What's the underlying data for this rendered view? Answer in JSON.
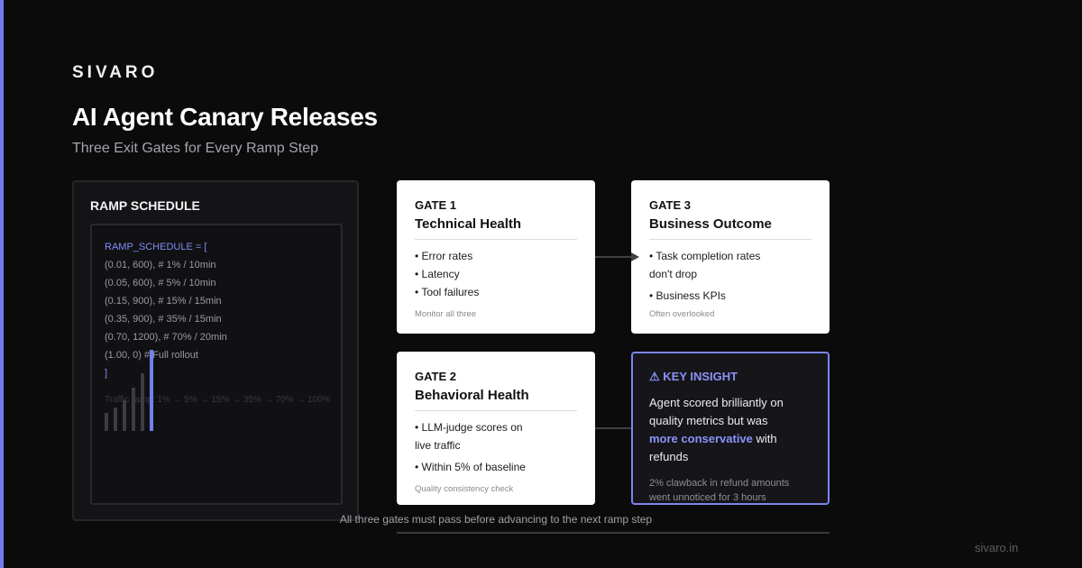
{
  "brand": "SIVARO",
  "title": "AI Agent Canary Releases",
  "subtitle": "Three Exit Gates for Every Ramp Step",
  "ramp": {
    "title": "RAMP SCHEDULE",
    "code": [
      "RAMP_SCHEDULE = [",
      "(0.01, 600), # 1% / 10min",
      "(0.05, 600), # 5% / 10min",
      "(0.15, 900), # 15% / 15min",
      "(0.35, 900), # 35% / 15min",
      "(0.70, 1200), # 70% / 20min",
      "(1.00, 0) # Full rollout",
      "]"
    ],
    "traffic_label": "Traffic ramp: 1% → 5% → 15% → 35% → 70% → 100%",
    "traffic_steps_percent": [
      1,
      5,
      15,
      35,
      70,
      100
    ]
  },
  "gates": {
    "gate1": {
      "label": "GATE 1",
      "name": "Technical Health",
      "items": [
        "• Error rates",
        "• Latency",
        "• Tool failures"
      ],
      "note": "Monitor all three"
    },
    "gate2": {
      "label": "GATE 2",
      "name": "Behavioral Health",
      "items": [
        "• LLM-judge scores on",
        "live traffic",
        "• Within 5% of baseline"
      ],
      "note": "Quality consistency check"
    },
    "gate3": {
      "label": "GATE 3",
      "name": "Business Outcome",
      "items": [
        "• Task completion rates",
        "don't drop",
        "• Business KPIs"
      ],
      "note": "Often overlooked"
    }
  },
  "insight": {
    "heading": "⚠ KEY INSIGHT",
    "line1": "Agent scored brilliantly on",
    "line2": "quality metrics but was",
    "highlight": "more conservative",
    "line3_rest": " with",
    "line4": "refunds",
    "foot1": "2% clawback in refund amounts",
    "foot2": "went unnoticed for 3 hours"
  },
  "footer": "All three gates must pass before advancing to the next ramp step",
  "site": "sivaro.in",
  "colors": {
    "accent": "#7b85f0",
    "background": "#0b0b0c",
    "card": "#ffffff"
  }
}
